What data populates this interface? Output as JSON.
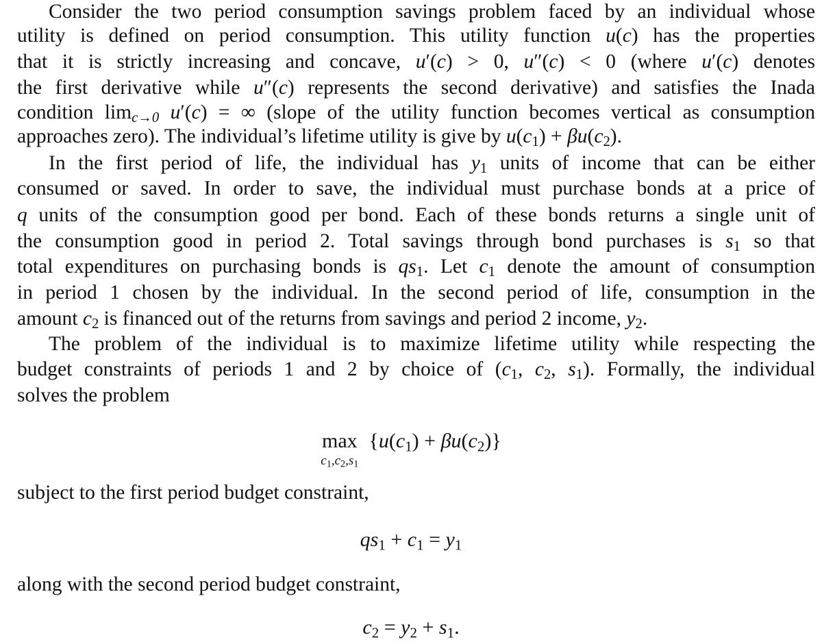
{
  "document": {
    "paragraph1": {
      "l1": "Consider the two period consumption savings problem faced by an individual whose",
      "l2": "utility is defined on period consumption. This utility function u(c) has the properties",
      "l3": "that it is strictly increasing and concave, u′(c) > 0, u″(c) < 0 (where u′(c) denotes",
      "l4": "the first derivative while u″(c) represents the second derivative) and satisfies the Inada",
      "l5": "condition lim c→0 u′(c) = ∞ (slope of the utility function becomes vertical as consumption",
      "l6": "approaches zero). The individual’s lifetime utility is give by u(c1) + βu(c2)."
    },
    "paragraph2": {
      "l1": "In the first period of life, the individual has y1 units of income that can be either",
      "l2": "consumed or saved. In order to save, the individual must purchase bonds at a price of",
      "l3": "q units of the consumption good per bond. Each of these bonds returns a single unit of",
      "l4": "the consumption good in period 2. Total savings through bond purchases is s1 so that",
      "l5": "total expenditures on purchasing bonds is qs1. Let c1 denote the amount of consumption",
      "l6": "in period 1 chosen by the individual. In the second period of life, consumption in the",
      "l7": "amount c2 is financed out of the returns from savings and period 2 income, y2."
    },
    "paragraph3": {
      "l1": "The problem of the individual is to maximize lifetime utility while respecting the",
      "l2": "budget constraints of periods 1 and 2 by choice of (c1, c2, s1). Formally, the individual",
      "l3": "solves the problem"
    },
    "objective": {
      "operator": "max",
      "under": "c1,c2,s1",
      "expression": "{u(c1) + βu(c2)}"
    },
    "text_subject_to": "subject to the first period budget constraint,",
    "constraint1": "qs1 + c1 = y1",
    "text_along_with": "along with the second period budget constraint,",
    "constraint2": "c2 = y2 + s1."
  }
}
